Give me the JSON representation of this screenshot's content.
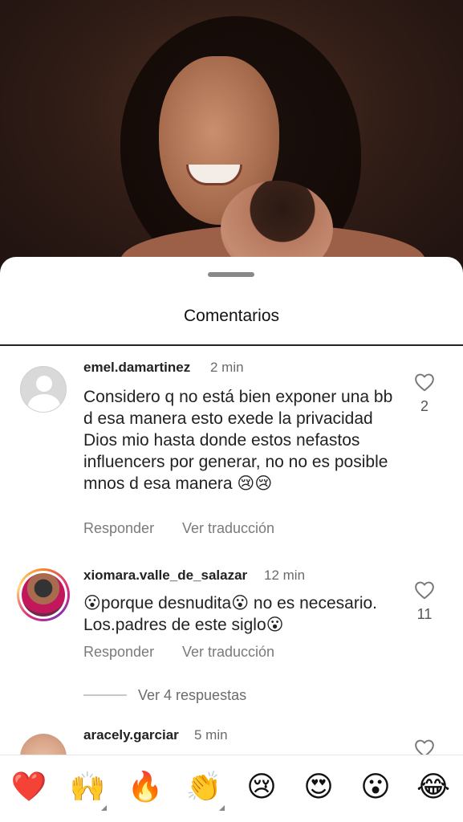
{
  "sheet": {
    "title": "Comentarios"
  },
  "comments": [
    {
      "username": "emel.damartinez",
      "time": "2 min",
      "text": "Considero q no está bien exponer una bb d esa manera esto exede la privacidad Dios mio hasta donde estos nefastos influencers por generar, no no es posible mnos d esa manera 😢😢",
      "reply_label": "Responder",
      "translate_label": "Ver traducción",
      "likes": "2",
      "avatar": "default-avatar"
    },
    {
      "username": "xiomara.valle_de_salazar",
      "time": "12 min",
      "text": "😮porque desnudita😮 no es necesario. Los.padres de este siglo😮",
      "reply_label": "Responder",
      "translate_label": "Ver traducción",
      "likes": "11",
      "avatar": "story-avatar",
      "view_replies": "Ver 4 respuestas"
    },
    {
      "username": "aracely.garciar",
      "time": "5 min",
      "avatar": "profile-avatar"
    }
  ],
  "emoji_bar": [
    {
      "name": "heart",
      "glyph": "❤️"
    },
    {
      "name": "raising-hands",
      "glyph": "🙌"
    },
    {
      "name": "fire",
      "glyph": "🔥"
    },
    {
      "name": "clapping-hands",
      "glyph": "👏"
    },
    {
      "name": "crying-face",
      "glyph": "😢"
    },
    {
      "name": "heart-eyes",
      "glyph": "😍"
    },
    {
      "name": "astonished-face",
      "glyph": "😮"
    },
    {
      "name": "tears-of-joy",
      "glyph": "😂"
    }
  ],
  "colors": {
    "text": "#222222",
    "muted": "#7a7a7a",
    "heart": "#e0245e"
  }
}
